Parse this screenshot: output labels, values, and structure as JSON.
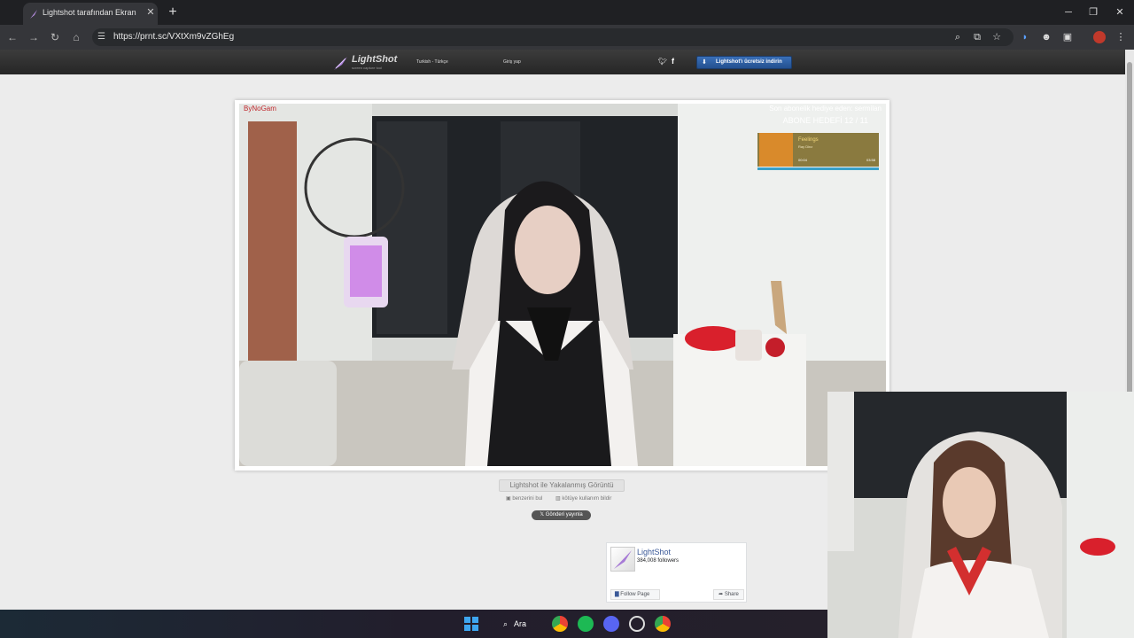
{
  "browser": {
    "tab_title": "Lightshot tarafından Ekran Görüntüsü",
    "url": "https://prnt.sc/VXtXm9vZGhEg",
    "new_tab": "+",
    "close_tab": "✕"
  },
  "lightshot": {
    "logo": "LightShot",
    "logo_sub": "screen capture tool",
    "language": "Turkish - Türkçe",
    "login": "Giriş yap",
    "download_button": "Lightshot'ı ücretsiz indirin",
    "caption": "Lightshot ile Yakalanmış Görüntü",
    "find_similar": "benzerini bul",
    "report_misuse": "kötüye kullanım bildir",
    "post_button": "Gönderi yayınla"
  },
  "stream_overlay": {
    "channel_tag": "ByNoGam",
    "last_gift": "Son abonelik hediye eden: sermilan",
    "sub_goal": "ABONE HEDEFİ 12 / 11",
    "song_title": "Feelings",
    "song_artist": "Ray Dinz",
    "time_start": "00:04",
    "time_end": "03:58"
  },
  "fb_widget": {
    "page_name": "LightShot",
    "followers": "384,008 followers",
    "follow": "Follow Page",
    "share": "Share"
  },
  "taskbar": {
    "search": "Ara"
  },
  "colors": {
    "accent": "#3a6fb8",
    "page_bg": "#ececec",
    "header_bg": "#2f2f2f"
  }
}
